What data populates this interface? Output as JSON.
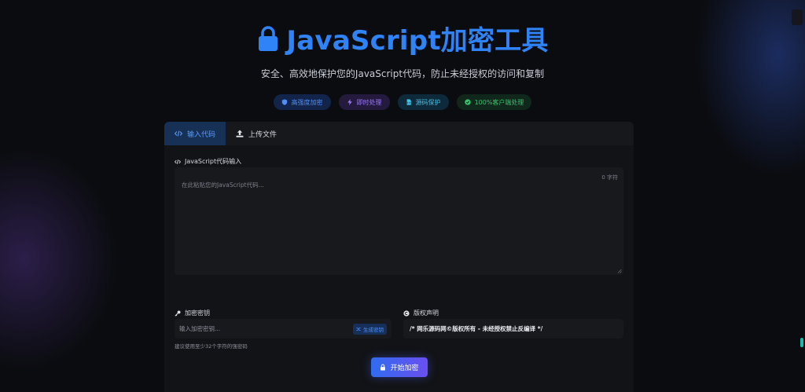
{
  "header": {
    "title": "JavaScript加密工具",
    "subtitle": "安全、高效地保护您的JavaScript代码，防止未经授权的访问和复制",
    "title_color": "#2f83f6"
  },
  "badges": [
    {
      "label": "高强度加密",
      "icon": "shield-icon",
      "color": "#4f8ff7"
    },
    {
      "label": "即时处理",
      "icon": "bolt-icon",
      "color": "#9b7cf2"
    },
    {
      "label": "源码保护",
      "icon": "file-code-icon",
      "color": "#46c1e6"
    },
    {
      "label": "100%客户端处理",
      "icon": "check-circle-icon",
      "color": "#38c46e"
    }
  ],
  "tabs": [
    {
      "label": "输入代码",
      "icon": "code-icon",
      "active": true
    },
    {
      "label": "上传文件",
      "icon": "upload-icon",
      "active": false
    }
  ],
  "code_input": {
    "label": "JavaScript代码输入",
    "placeholder": "在此粘贴您的JavaScript代码...",
    "char_count": "0 字符"
  },
  "key_input": {
    "label": "加密密钥",
    "placeholder": "输入加密密钥...",
    "generate_label": "生成密钥",
    "hint": "建议使用至少32个字符的强密码"
  },
  "copyright": {
    "label": "版权声明",
    "value": "/* 网乐源码网©版权所有 - 未经授权禁止反编译 */"
  },
  "encrypt_button": {
    "label": "开始加密",
    "icon": "lock-icon"
  }
}
